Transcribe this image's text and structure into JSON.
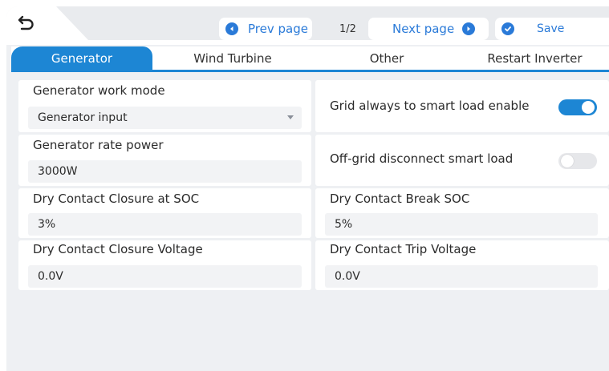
{
  "toolbar": {
    "prev_label": "Prev page",
    "page_indicator": "1/2",
    "next_label": "Next page",
    "save_label": "Save"
  },
  "tabs": [
    {
      "label": "Generator",
      "active": true
    },
    {
      "label": "Wind Turbine",
      "active": false
    },
    {
      "label": "Other",
      "active": false
    },
    {
      "label": "Restart Inverter",
      "active": false
    }
  ],
  "left": {
    "work_mode": {
      "label": "Generator work mode",
      "value": "Generator input"
    },
    "rate_power": {
      "label": "Generator rate power",
      "value": "3000W"
    },
    "closure_soc": {
      "label": "Dry Contact Closure at SOC",
      "value": "3%"
    },
    "closure_voltage": {
      "label": "Dry Contact Closure Voltage",
      "value": "0.0V"
    }
  },
  "right": {
    "grid_smart_load": {
      "label": "Grid always to smart load enable",
      "enabled": true
    },
    "offgrid_disconnect": {
      "label": "Off-grid disconnect smart load",
      "enabled": false
    },
    "break_soc": {
      "label": "Dry Contact Break SOC",
      "value": "5%"
    },
    "trip_voltage": {
      "label": "Dry Contact Trip Voltage",
      "value": "0.0V"
    }
  },
  "colors": {
    "accent": "#1d86d4",
    "background": "#eef0f3",
    "card": "#ffffff",
    "field": "#f2f3f5"
  },
  "icons": {
    "back": "back-arrow-icon",
    "prev": "circle-left-icon",
    "next": "circle-right-icon",
    "save": "circle-check-icon",
    "dropdown": "dropdown-triangle-icon"
  }
}
